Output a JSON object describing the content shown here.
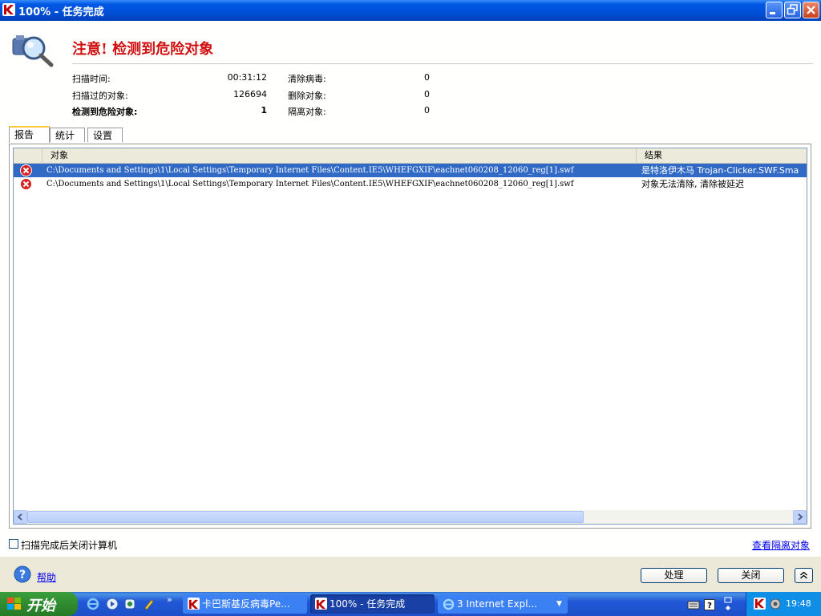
{
  "window": {
    "title": "100% - 任务完成"
  },
  "header": {
    "alert_title": "注意! 检测到危险对象"
  },
  "stats": {
    "left": [
      {
        "label": "扫描时间:",
        "value": "00:31:12",
        "bold": false
      },
      {
        "label": "扫描过的对象:",
        "value": "126694",
        "bold": false
      },
      {
        "label": "检测到危险对象:",
        "value": "1",
        "bold": true
      }
    ],
    "right": [
      {
        "label": "清除病毒:",
        "value": "0"
      },
      {
        "label": "删除对象:",
        "value": "0"
      },
      {
        "label": "隔离对象:",
        "value": "0"
      }
    ]
  },
  "tabs": [
    {
      "label": "报告",
      "active": true
    },
    {
      "label": "统计",
      "active": false
    },
    {
      "label": "设置",
      "active": false
    }
  ],
  "list": {
    "columns": [
      "对象",
      "结果"
    ],
    "rows": [
      {
        "path": "C:\\Documents and Settings\\1\\Local Settings\\Temporary Internet Files\\Content.IE5\\WHEFGXIF\\eachnet060208_12060_reg[1].swf",
        "result": "是特洛伊木马 Trojan-Clicker.SWF.Sma",
        "selected": true
      },
      {
        "path": "C:\\Documents and Settings\\1\\Local Settings\\Temporary Internet Files\\Content.IE5\\WHEFGXIF\\eachnet060208_12060_reg[1].swf",
        "result": "对象无法清除, 清除被延迟",
        "selected": false
      }
    ]
  },
  "options": {
    "shutdown_label": "扫描完成后关闭计算机",
    "shutdown_checked": false
  },
  "links": {
    "view_quarantine": "查看隔离对象",
    "help": "帮助"
  },
  "buttons": {
    "process": "处理",
    "close": "关闭"
  },
  "taskbar": {
    "start_label": "开始",
    "items": [
      {
        "label": "卡巴斯基反病毒Pe...",
        "active": false
      },
      {
        "label": "100% - 任务完成",
        "active": true
      },
      {
        "label": "3 Internet Expl...",
        "active": false
      }
    ],
    "clock": "19:48"
  },
  "colors": {
    "alert": "#d01010",
    "selection": "#316ac5",
    "titlebar": "#0058e6",
    "taskbar": "#2157d7"
  }
}
